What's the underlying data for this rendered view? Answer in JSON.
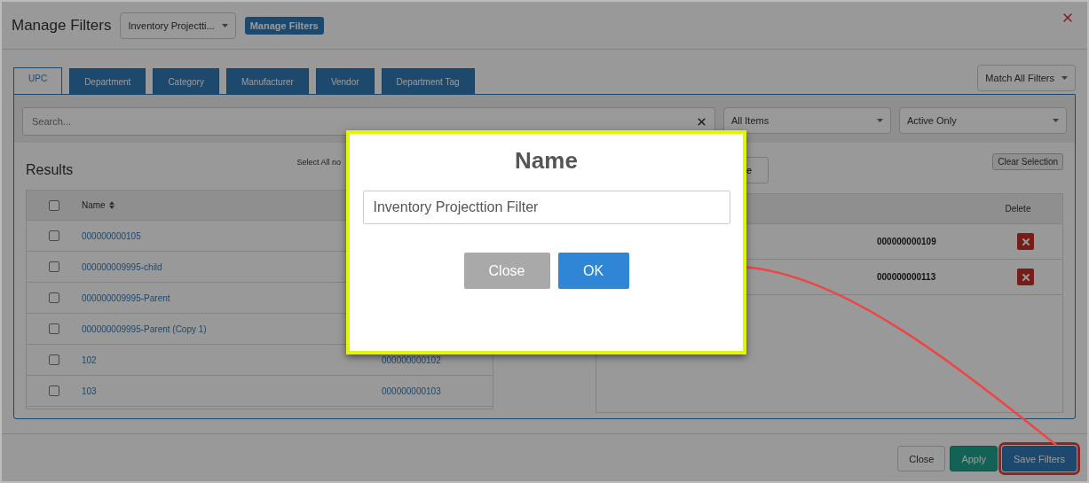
{
  "window": {
    "title": "Manage Filters"
  },
  "filter_select": {
    "value": "Inventory Projectti..."
  },
  "manage_button": {
    "label": "Manage Filters"
  },
  "tabs": [
    {
      "label": "UPC",
      "selected": true
    },
    {
      "label": "Department",
      "selected": false
    },
    {
      "label": "Category",
      "selected": false
    },
    {
      "label": "Manufacturer",
      "selected": false
    },
    {
      "label": "Vendor",
      "selected": false
    },
    {
      "label": "Department Tag",
      "selected": false
    }
  ],
  "match_select": {
    "value": "Match All Filters"
  },
  "search": {
    "placeholder": "Search..."
  },
  "item_select": {
    "value": "All Items"
  },
  "status_select": {
    "value": "Active Only"
  },
  "results": {
    "title": "Results",
    "select_all": "Select All no",
    "name_header": "Name",
    "all_checked": false,
    "rows": [
      {
        "name": "000000000105",
        "checked": false
      },
      {
        "name": "000000009995-child",
        "checked": false
      },
      {
        "name": "000000009995-Parent",
        "checked": false
      },
      {
        "name": "000000009995-Parent (Copy 1)",
        "checked": false
      },
      {
        "name": "102",
        "code": "000000000102",
        "checked": false
      },
      {
        "name": "103",
        "code": "000000000103",
        "checked": false
      }
    ]
  },
  "selection": {
    "button_partial": "e",
    "clear_button": "Clear Selection",
    "delete_header": "Delete",
    "rows": [
      {
        "code": "000000000109"
      },
      {
        "code": "000000000113"
      }
    ]
  },
  "footer": {
    "buttons": [
      {
        "label": "Close",
        "kind": "default",
        "highlighted": false
      },
      {
        "label": "Apply",
        "kind": "success",
        "highlighted": false
      },
      {
        "label": "Save Filters",
        "kind": "primary",
        "highlighted": true
      }
    ]
  },
  "dialog": {
    "title": "Name",
    "value": "Inventory Projecttion Filter",
    "buttons": [
      {
        "label": "Close",
        "kind": "secondary"
      },
      {
        "label": "OK",
        "kind": "primary"
      }
    ]
  }
}
